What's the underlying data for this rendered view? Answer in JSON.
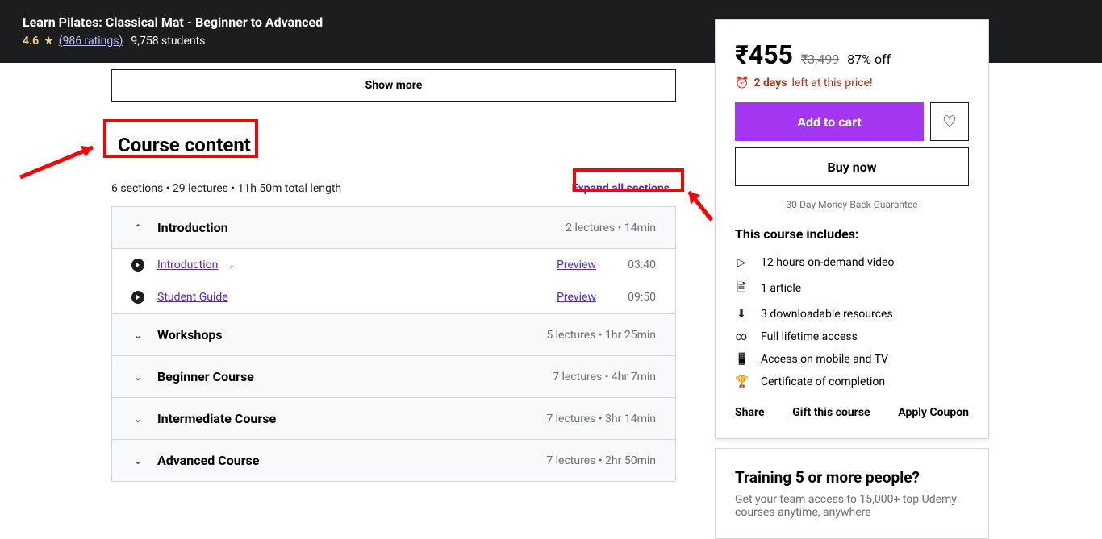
{
  "topbar": {
    "title": "Learn Pilates: Classical Mat - Beginner to Advanced",
    "rating": "4.6",
    "ratings_link": "(986 ratings)",
    "students": "9,758 students"
  },
  "showmore_label": "Show more",
  "cc_heading": "Course content",
  "cc_meta": "6 sections • 29 lectures • 11h 50m total length",
  "expand_label": "Expand all sections",
  "sections": [
    {
      "title": "Introduction",
      "meta": "2 lectures • 14min",
      "open": true,
      "lectures": [
        {
          "title": "Introduction",
          "preview": "Preview",
          "time": "03:40",
          "has_chev": true
        },
        {
          "title": "Student Guide",
          "preview": "Preview",
          "time": "09:50",
          "has_chev": false
        }
      ]
    },
    {
      "title": "Workshops",
      "meta": "5 lectures • 1hr 25min",
      "open": false
    },
    {
      "title": "Beginner Course",
      "meta": "7 lectures • 4hr 7min",
      "open": false
    },
    {
      "title": "Intermediate Course",
      "meta": "7 lectures • 3hr 14min",
      "open": false
    },
    {
      "title": "Advanced Course",
      "meta": "7 lectures • 2hr 50min",
      "open": false
    }
  ],
  "sidebar": {
    "price": "₹455",
    "orig": "₹3,499",
    "pct": "87% off",
    "deadline_bold": "2 days",
    "deadline_rest": "left at this price!",
    "cart": "Add to cart",
    "buy": "Buy now",
    "guarantee": "30-Day Money-Back Guarantee",
    "includes_h": "This course includes:",
    "includes": [
      {
        "icon": "▷",
        "text": "12 hours on-demand video"
      },
      {
        "icon": "🗎",
        "text": "1 article"
      },
      {
        "icon": "⬇",
        "text": "3 downloadable resources"
      },
      {
        "icon": "∞",
        "text": "Full lifetime access"
      },
      {
        "icon": "📱",
        "text": "Access on mobile and TV"
      },
      {
        "icon": "🏆",
        "text": "Certificate of completion"
      }
    ],
    "share": "Share",
    "gift": "Gift this course",
    "coupon": "Apply Coupon"
  },
  "training": {
    "heading": "Training 5 or more people?",
    "text": "Get your team access to 15,000+ top Udemy courses anytime, anywhere"
  }
}
